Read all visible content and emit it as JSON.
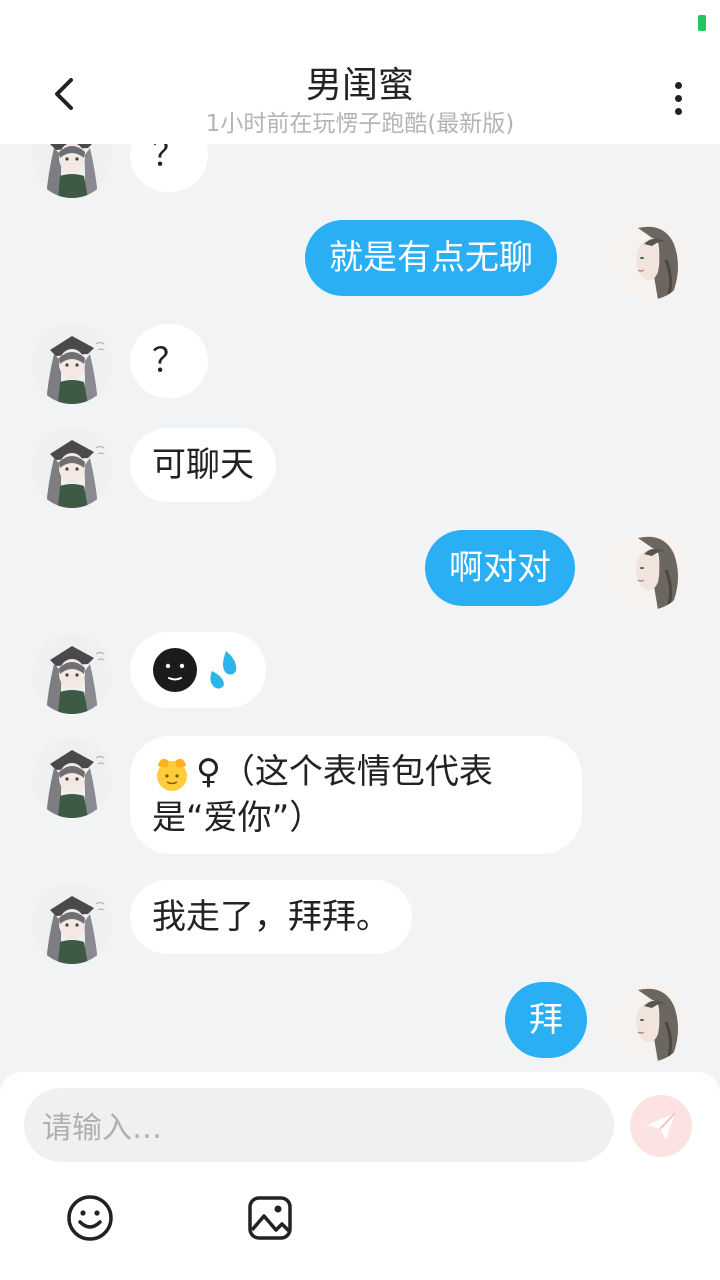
{
  "header": {
    "title": "男闺蜜",
    "subtitle": "1小时前在玩愣子跑酷(最新版)"
  },
  "messages": [
    {
      "side": "left",
      "text": "？"
    },
    {
      "side": "right",
      "text": "就是有点无聊"
    },
    {
      "side": "left",
      "text": "？"
    },
    {
      "side": "left",
      "text": "可聊天"
    },
    {
      "side": "right",
      "text": "啊对对"
    },
    {
      "side": "left",
      "emojis": [
        "dark-face-emoji",
        "sweat-drops-emoji"
      ]
    },
    {
      "side": "left",
      "emoji": "heart-hands-emoji",
      "line1": "♀（这个表情包代表",
      "line2": "是“爱你”）"
    },
    {
      "side": "left",
      "text": "我走了，拜拜。"
    },
    {
      "side": "right",
      "text": "拜"
    }
  ],
  "input": {
    "placeholder": "请输入…"
  },
  "icons": {
    "back": "chevron-left-icon",
    "more": "more-vertical-icon",
    "send": "send-icon",
    "emoji": "smiley-icon",
    "image": "image-icon"
  },
  "colors": {
    "accent": "#2aaef4",
    "background": "#f2f3f4",
    "send_button": "#fde2e2",
    "online": "#22c55e"
  }
}
